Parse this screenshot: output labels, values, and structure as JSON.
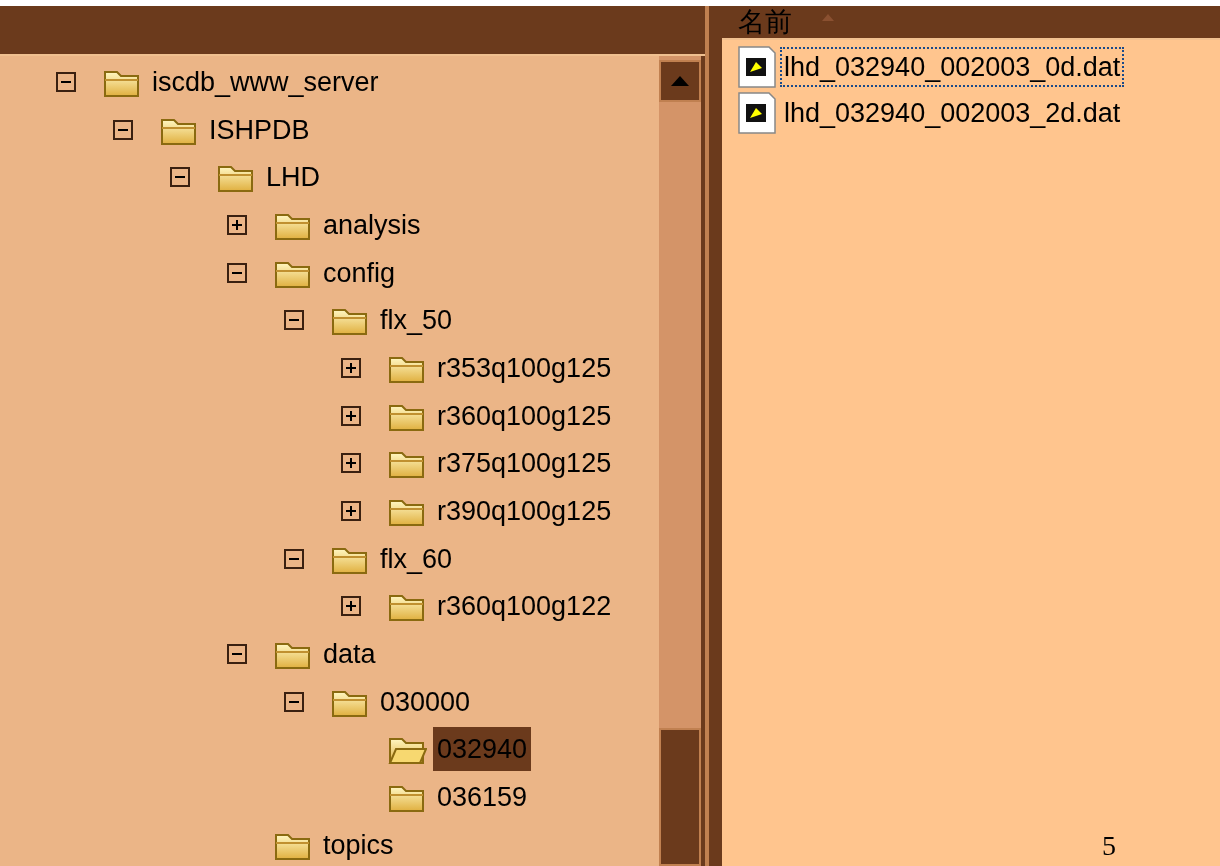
{
  "tree": [
    {
      "label": "iscdb_www_server",
      "kind": "node",
      "expanded": true,
      "selected": false,
      "children": [
        {
          "label": "ISHPDB",
          "kind": "node",
          "expanded": true,
          "selected": false,
          "children": [
            {
              "label": "LHD",
              "kind": "node",
              "expanded": true,
              "selected": false,
              "children": [
                {
                  "label": "analysis",
                  "kind": "node",
                  "expanded": false,
                  "selected": false
                },
                {
                  "label": "config",
                  "kind": "node",
                  "expanded": true,
                  "selected": false,
                  "children": [
                    {
                      "label": "flx_50",
                      "kind": "node",
                      "expanded": true,
                      "selected": false,
                      "children": [
                        {
                          "label": "r353q100g125",
                          "kind": "node",
                          "expanded": false,
                          "selected": false
                        },
                        {
                          "label": "r360q100g125",
                          "kind": "node",
                          "expanded": false,
                          "selected": false
                        },
                        {
                          "label": "r375q100g125",
                          "kind": "node",
                          "expanded": false,
                          "selected": false
                        },
                        {
                          "label": "r390q100g125",
                          "kind": "node",
                          "expanded": false,
                          "selected": false
                        }
                      ]
                    },
                    {
                      "label": "flx_60",
                      "kind": "node",
                      "expanded": true,
                      "selected": false,
                      "children": [
                        {
                          "label": "r360q100g122",
                          "kind": "node",
                          "expanded": false,
                          "selected": false
                        }
                      ]
                    }
                  ]
                },
                {
                  "label": "data",
                  "kind": "node",
                  "expanded": true,
                  "selected": false,
                  "children": [
                    {
                      "label": "030000",
                      "kind": "node",
                      "expanded": true,
                      "selected": false,
                      "children": [
                        {
                          "label": "032940",
                          "kind": "leaf",
                          "selected": true
                        },
                        {
                          "label": "036159",
                          "kind": "leaf",
                          "selected": false
                        }
                      ]
                    }
                  ]
                },
                {
                  "label": "topics",
                  "kind": "leaf",
                  "selected": false
                }
              ]
            }
          ]
        }
      ]
    }
  ],
  "list": {
    "column": "名前",
    "files": [
      {
        "name": "lhd_032940_002003_0d.dat",
        "focused": true
      },
      {
        "name": "lhd_032940_002003_2d.dat",
        "focused": false
      }
    ]
  },
  "page_number": "5"
}
